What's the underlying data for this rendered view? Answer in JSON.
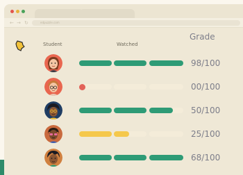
{
  "browser": {
    "url": "edpuzzle.com",
    "nav_back": "←",
    "nav_forward": "→",
    "nav_reload": "↻"
  },
  "table": {
    "headers": {
      "student": "Student",
      "watched": "Watched",
      "grade": "Grade"
    },
    "rows": [
      {
        "grade": "98/100",
        "watched_fraction": 1.0,
        "bar_color": "#2e9b76",
        "avatar": "student-avatar-1"
      },
      {
        "grade": "00/100",
        "watched_fraction": 0.0,
        "bar_color": "#e26259",
        "avatar": "student-avatar-2"
      },
      {
        "grade": "50/100",
        "watched_fraction": 0.9,
        "bar_color": "#2e9b76",
        "avatar": "student-avatar-3"
      },
      {
        "grade": "25/100",
        "watched_fraction": 0.48,
        "bar_color": "#f5c84c",
        "avatar": "student-avatar-4"
      },
      {
        "grade": "68/100",
        "watched_fraction": 1.0,
        "bar_color": "#2e9b76",
        "avatar": "student-avatar-5"
      }
    ]
  },
  "colors": {
    "track": "#f4ecd9",
    "green": "#2e9b76",
    "red": "#e26259",
    "yellow": "#f5c84c"
  }
}
